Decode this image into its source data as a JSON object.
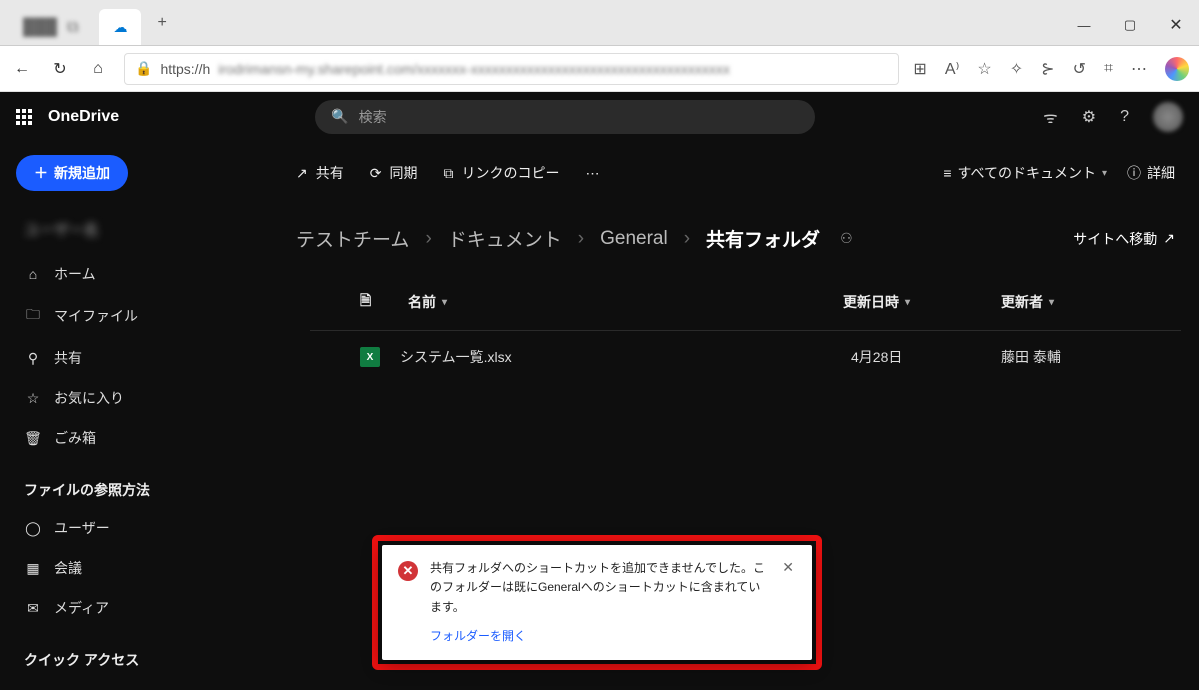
{
  "browser": {
    "active_tab_title": "",
    "address_prefix": "https://h",
    "address_blur": "irodrimansn-my.sharepoint.com/xxxxxxx-xxxxxxxxxxxxxxxxxxxxxxxxxxxxxxxxxxxxx"
  },
  "header": {
    "app_title": "OneDrive",
    "search_placeholder": "検索"
  },
  "sidebar": {
    "new_label": "新規追加",
    "user_label": "ユーザー名",
    "items": [
      {
        "icon": "⌂",
        "label": "ホーム"
      },
      {
        "icon": "🗀",
        "label": "マイファイル"
      },
      {
        "icon": "⚲",
        "label": "共有"
      },
      {
        "icon": "☆",
        "label": "お気に入り"
      },
      {
        "icon": "🗑",
        "label": "ごみ箱"
      }
    ],
    "section1": "ファイルの参照方法",
    "browse": [
      {
        "icon": "◯",
        "label": "ユーザー"
      },
      {
        "icon": "▦",
        "label": "会議"
      },
      {
        "icon": "✉",
        "label": "メディア"
      }
    ],
    "section2": "クイック アクセス"
  },
  "commandbar": {
    "share": "共有",
    "sync": "同期",
    "copy_link": "リンクのコピー",
    "view_label": "すべてのドキュメント",
    "details": "詳細"
  },
  "breadcrumbs": {
    "items": [
      "テストチーム",
      "ドキュメント",
      "General"
    ],
    "current": "共有フォルダ",
    "site_link": "サイトへ移動"
  },
  "table": {
    "headers": {
      "name": "名前",
      "modified": "更新日時",
      "by": "更新者"
    },
    "rows": [
      {
        "name": "システム一覧.xlsx",
        "date": "4月28日",
        "by": "藤田 泰輔"
      }
    ]
  },
  "toast": {
    "line1": "共有フォルダへのショートカットを追加できませんでした。このフォルダーは既にGeneralへのショートカットに含まれています。",
    "link": "フォルダーを開く"
  }
}
